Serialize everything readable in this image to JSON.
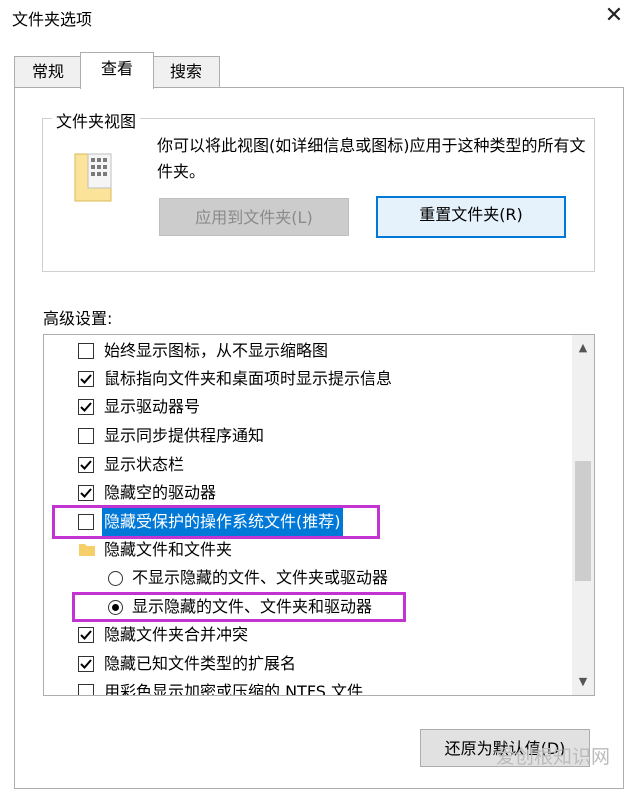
{
  "window": {
    "title": "文件夹选项",
    "close_glyph": "✕"
  },
  "tabs": [
    {
      "label": "常规"
    },
    {
      "label": "查看",
      "active": true
    },
    {
      "label": "搜索"
    }
  ],
  "folder_views": {
    "label": "文件夹视图",
    "description": "你可以将此视图(如详细信息或图标)应用于这种类型的所有文件夹。",
    "apply_button": "应用到文件夹(L)",
    "reset_button": "重置文件夹(R)"
  },
  "advanced": {
    "label": "高级设置:",
    "items": [
      {
        "type": "checkbox",
        "checked": false,
        "label": "始终显示图标，从不显示缩略图"
      },
      {
        "type": "checkbox",
        "checked": true,
        "label": "鼠标指向文件夹和桌面项时显示提示信息"
      },
      {
        "type": "checkbox",
        "checked": true,
        "label": "显示驱动器号"
      },
      {
        "type": "checkbox",
        "checked": false,
        "label": "显示同步提供程序通知"
      },
      {
        "type": "checkbox",
        "checked": true,
        "label": "显示状态栏"
      },
      {
        "type": "checkbox",
        "checked": true,
        "label": "隐藏空的驱动器"
      },
      {
        "type": "checkbox",
        "checked": false,
        "label": "隐藏受保护的操作系统文件(推荐)",
        "selected": true
      },
      {
        "type": "folder",
        "label": "隐藏文件和文件夹"
      },
      {
        "type": "radio",
        "checked": false,
        "label": "不显示隐藏的文件、文件夹或驱动器"
      },
      {
        "type": "radio",
        "checked": true,
        "label": "显示隐藏的文件、文件夹和驱动器"
      },
      {
        "type": "checkbox",
        "checked": true,
        "label": "隐藏文件夹合并冲突"
      },
      {
        "type": "checkbox",
        "checked": true,
        "label": "隐藏已知文件类型的扩展名"
      },
      {
        "type": "checkbox",
        "checked": false,
        "label": "用彩色显示加密或压缩的 NTFS 文件"
      }
    ]
  },
  "restore_button": "还原为默认值(D)",
  "watermark": "爱创根知识网",
  "colors": {
    "accent": "#0078d7",
    "highlight": "#c233d1"
  }
}
